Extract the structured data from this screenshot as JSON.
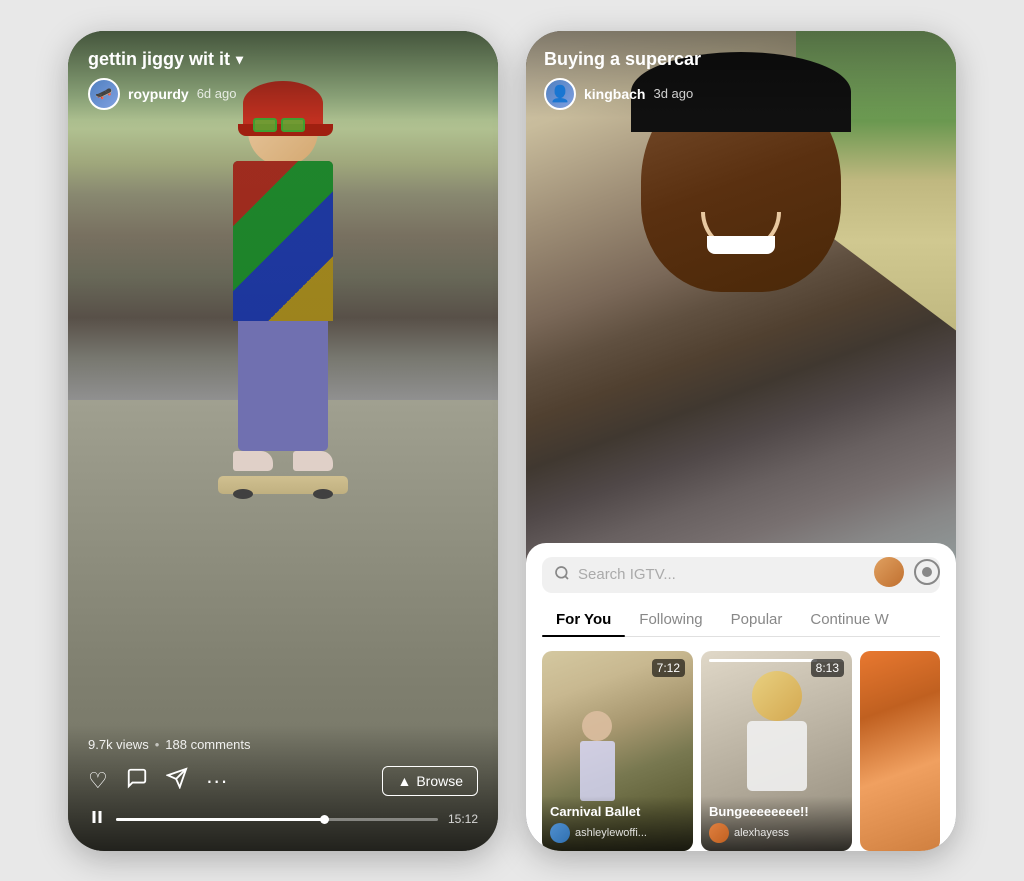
{
  "left_phone": {
    "video_title": "gettin jiggy wit it",
    "chevron": "▾",
    "username": "roypurdy",
    "time_ago": "6d ago",
    "stats": {
      "views": "9.7k views",
      "separator": "•",
      "comments": "188 comments"
    },
    "browse_label": "Browse",
    "browse_icon": "▲",
    "duration": "15:12",
    "actions": {
      "like_icon": "♡",
      "comment_icon": "💬",
      "share_icon": "▷",
      "more_icon": "···"
    }
  },
  "right_phone": {
    "video_title": "Buying a supercar",
    "username": "kingbach",
    "time_ago": "3d ago",
    "search_placeholder": "Search IGTV...",
    "tabs": [
      {
        "label": "For You",
        "active": true
      },
      {
        "label": "Following",
        "active": false
      },
      {
        "label": "Popular",
        "active": false
      },
      {
        "label": "Continue W",
        "active": false
      }
    ],
    "thumbnails": [
      {
        "title": "Carnival Ballet",
        "username": "ashleylewoffi...",
        "duration": "7:12",
        "has_progress": false
      },
      {
        "title": "Bungeeeeeeee!!",
        "username": "alexhayess",
        "duration": "8:13",
        "has_progress": true
      },
      {
        "title": "",
        "username": "",
        "duration": "",
        "has_progress": false
      }
    ]
  }
}
